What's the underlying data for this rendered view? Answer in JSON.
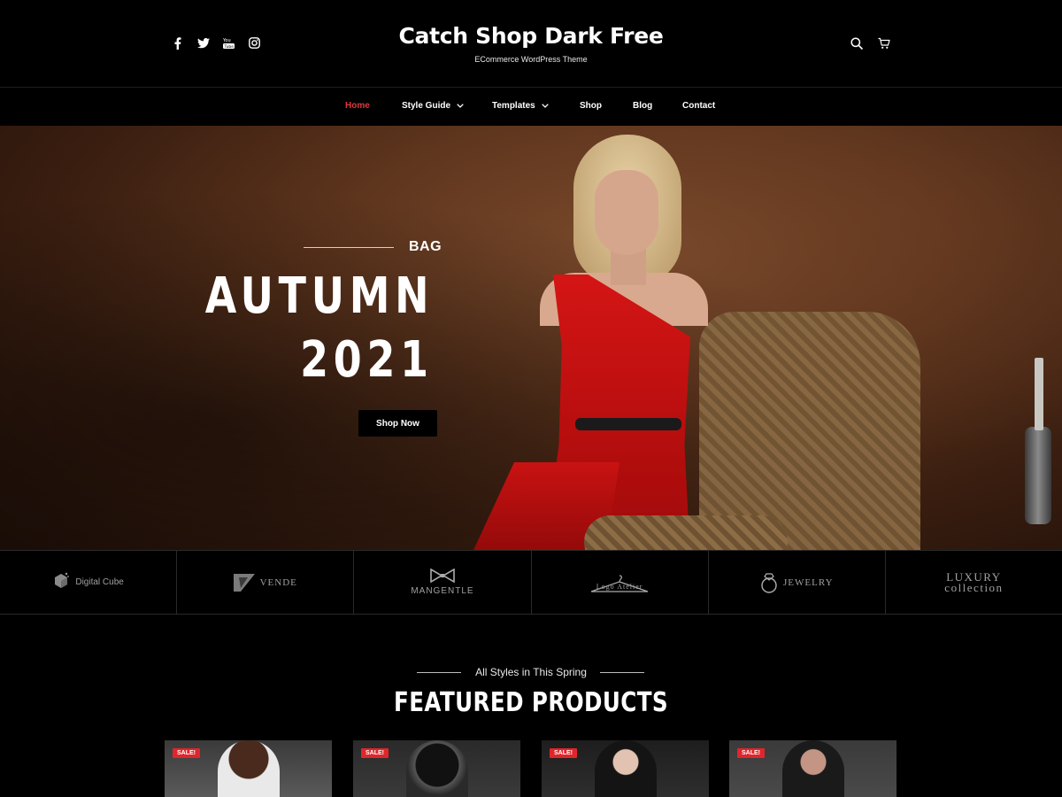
{
  "site": {
    "title": "Catch Shop Dark Free",
    "tagline": "ECommerce WordPress Theme"
  },
  "social": [
    {
      "icon": "facebook-icon",
      "glyph": "f"
    },
    {
      "icon": "twitter-icon",
      "glyph": "t"
    },
    {
      "icon": "youtube-icon",
      "glyph": "You"
    },
    {
      "icon": "instagram-icon",
      "glyph": "◎"
    }
  ],
  "tools": {
    "search_icon": "search-icon",
    "cart_icon": "cart-icon"
  },
  "nav": {
    "items": [
      {
        "label": "Home",
        "active": true,
        "has_dropdown": false
      },
      {
        "label": "Style Guide",
        "active": false,
        "has_dropdown": true
      },
      {
        "label": "Templates",
        "active": false,
        "has_dropdown": true
      },
      {
        "label": "Shop",
        "active": false,
        "has_dropdown": false
      },
      {
        "label": "Blog",
        "active": false,
        "has_dropdown": false
      },
      {
        "label": "Contact",
        "active": false,
        "has_dropdown": false
      }
    ],
    "active_color": "#e0373b"
  },
  "hero": {
    "kicker": "BAG",
    "headline_1": "AUTUMN",
    "headline_2": "2021",
    "button": "Shop Now"
  },
  "brands": [
    {
      "name": "Digital Cube",
      "icon": "cube-logo-icon"
    },
    {
      "name": "VENDE",
      "icon": "vende-logo-icon"
    },
    {
      "name": "MANGENTLE",
      "icon": "bowtie-logo-icon"
    },
    {
      "name": "Logo Atelier",
      "icon": "hanger-logo-icon"
    },
    {
      "name": "JEWELRY",
      "icon": "ring-logo-icon"
    },
    {
      "name": "LUXURY collection",
      "icon": "luxury-logo-icon"
    }
  ],
  "featured": {
    "subtitle": "All Styles in This Spring",
    "title": "FEATURED PRODUCTS"
  },
  "products": [
    {
      "badge": "SALE!"
    },
    {
      "badge": "SALE!"
    },
    {
      "badge": "SALE!"
    },
    {
      "badge": "SALE!"
    }
  ],
  "colors": {
    "background": "#000000",
    "sale_badge": "#e0262b"
  }
}
